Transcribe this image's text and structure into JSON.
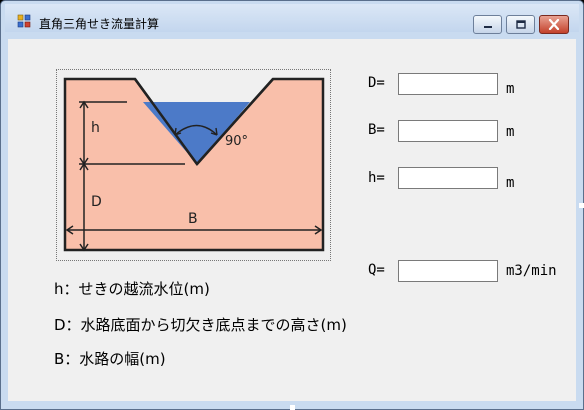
{
  "window": {
    "title": "直角三角せき流量計算"
  },
  "diagram": {
    "angle_label": "90°",
    "h_label": "h",
    "d_label": "D",
    "b_label": "B"
  },
  "inputs": {
    "d": {
      "label": "D=",
      "value": "",
      "unit": "m"
    },
    "b": {
      "label": "B=",
      "value": "",
      "unit": "m"
    },
    "h": {
      "label": "h=",
      "value": "",
      "unit": "m"
    },
    "q": {
      "label": "Q=",
      "value": "",
      "unit": "m3/min"
    }
  },
  "legend": {
    "h": "h：せきの越流水位(m)",
    "d": "D：水路底面から切欠き底点までの高さ(m)",
    "b": "B：水路の幅(m)"
  },
  "colors": {
    "wall": "#f9bfaa",
    "water": "#4c7ac8",
    "frame_bg": "#f0f0f0"
  },
  "icons": {
    "app": "app-icon",
    "minimize": "minimize-icon",
    "maximize": "maximize-icon",
    "close": "close-icon"
  }
}
